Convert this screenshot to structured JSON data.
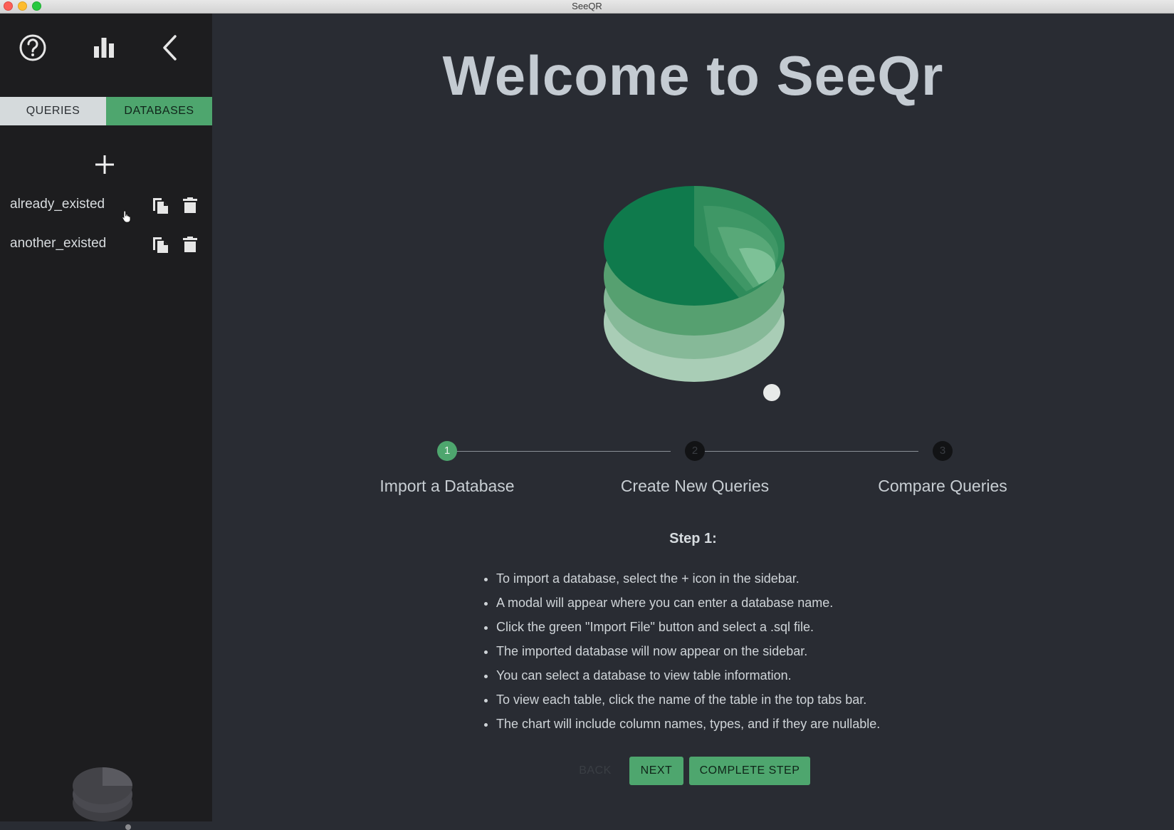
{
  "window": {
    "title": "SeeQR"
  },
  "sidebar": {
    "tabs": [
      {
        "label": "QUERIES",
        "active": false
      },
      {
        "label": "DATABASES",
        "active": true
      }
    ],
    "icons": [
      "help-icon",
      "bar-chart-icon",
      "chevron-left-icon",
      "plus-icon",
      "copy-icon",
      "trash-icon"
    ],
    "databases": [
      {
        "name": "already_existed"
      },
      {
        "name": "another_existed"
      }
    ]
  },
  "main": {
    "title": "Welcome to SeeQr",
    "steps": [
      {
        "number": "1",
        "label": "Import a Database",
        "active": true
      },
      {
        "number": "2",
        "label": "Create New Queries",
        "active": false
      },
      {
        "number": "3",
        "label": "Compare Queries",
        "active": false
      }
    ],
    "step_heading": "Step 1:",
    "instructions": [
      "To import a database, select the + icon in the sidebar.",
      "A modal will appear where you can enter a database name.",
      "Click the green \"Import File\" button and select a .sql file.",
      "The imported database will now appear on the sidebar.",
      "You can select a database to view table information.",
      "To view each table, click the name of the table in the top tabs bar.",
      "The chart will include column names, types, and if they are nullable."
    ],
    "buttons": {
      "back": "BACK",
      "next": "NEXT",
      "complete": "COMPLETE STEP"
    }
  },
  "colors": {
    "accent": "#4ea66e",
    "sidebar_bg": "#1d1d1f",
    "main_bg": "#292c33"
  }
}
